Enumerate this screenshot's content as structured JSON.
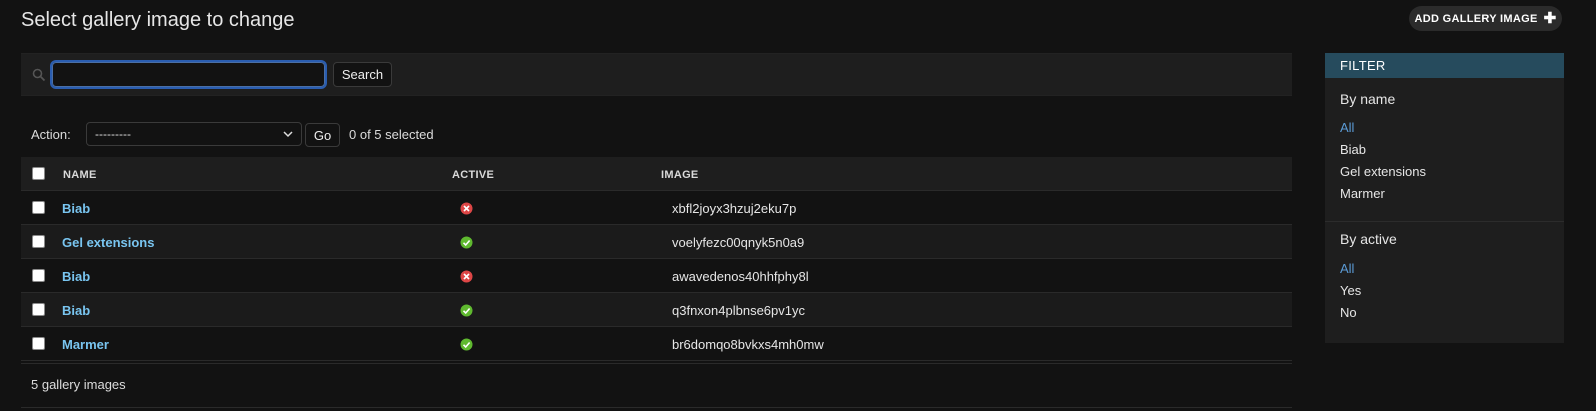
{
  "header": {
    "title": "Select gallery image to change",
    "add_button_label": "ADD GALLERY IMAGE",
    "add_icon": "plus-icon"
  },
  "search": {
    "value": "",
    "placeholder": "",
    "button_label": "Search",
    "icon": "search-icon"
  },
  "actions": {
    "label": "Action:",
    "selected_option": "---------",
    "go_label": "Go",
    "selected_count": "0 of 5 selected"
  },
  "table": {
    "columns": [
      "NAME",
      "ACTIVE",
      "IMAGE"
    ],
    "rows": [
      {
        "name": "Biab",
        "active": false,
        "image": "xbfl2joyx3hzuj2eku7p"
      },
      {
        "name": "Gel extensions",
        "active": true,
        "image": "voelyfezc00qnyk5n0a9"
      },
      {
        "name": "Biab",
        "active": false,
        "image": "awavedenos40hhfphy8l"
      },
      {
        "name": "Biab",
        "active": true,
        "image": "q3fnxon4plbnse6pv1yc"
      },
      {
        "name": "Marmer",
        "active": true,
        "image": "br6domqo8bvkxs4mh0mw"
      }
    ]
  },
  "paginator": {
    "text": "5 gallery images"
  },
  "filter": {
    "header": "FILTER",
    "groups": [
      {
        "title": "By name",
        "items": [
          "All",
          "Biab",
          "Gel extensions",
          "Marmer"
        ],
        "selected": "All"
      },
      {
        "title": "By active",
        "items": [
          "All",
          "Yes",
          "No"
        ],
        "selected": "All"
      }
    ]
  },
  "colors": {
    "background": "#121212",
    "link": "#79c5f0",
    "filter_header": "#264b5d",
    "selected_filter": "#5b9bd5",
    "active_true": "#5fb92f",
    "active_false": "#dd4646"
  }
}
